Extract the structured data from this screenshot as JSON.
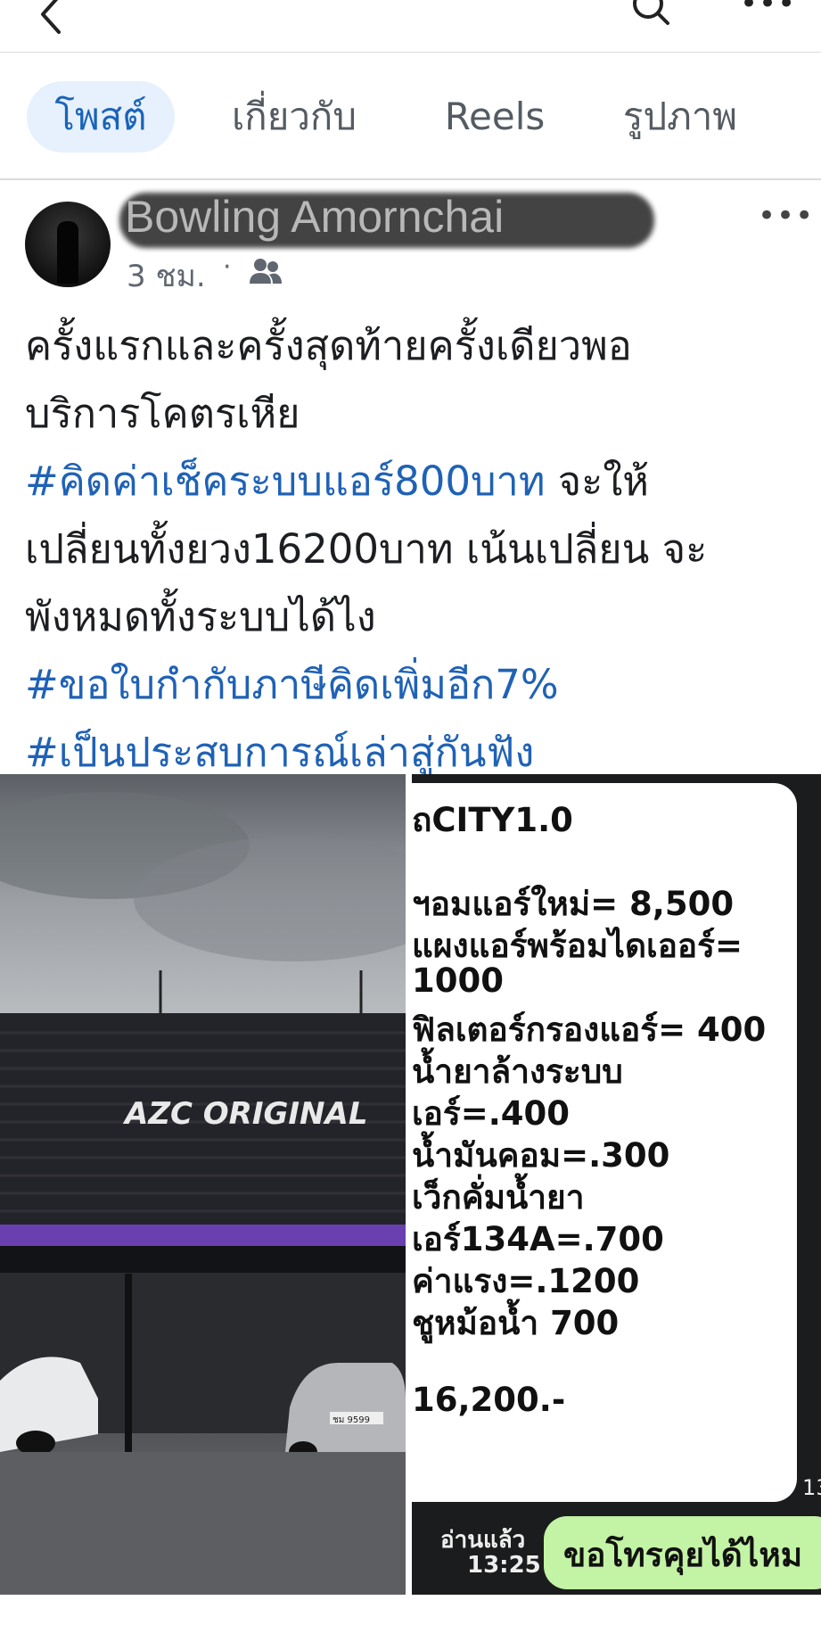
{
  "header": {
    "back_icon": "back-chevron-icon",
    "search_icon": "search-icon",
    "more_icon": "more-dots-icon",
    "more_glyph": "•••"
  },
  "tabs": [
    {
      "label": "โพสต์",
      "selected": true
    },
    {
      "label": "เกี่ยวกับ",
      "selected": false
    },
    {
      "label": "Reels",
      "selected": false
    },
    {
      "label": "รูปภาพ",
      "selected": false
    }
  ],
  "post": {
    "author": "Bowling Amornchai",
    "time": "3 ชม.",
    "separator": "·",
    "audience_icon": "friends-icon",
    "more_glyph": "•••",
    "lines": [
      {
        "parts": [
          {
            "text": "ครั้งแรกและครั้งสุดท้ายครั้งเดียวพอ",
            "tag": false
          }
        ]
      },
      {
        "parts": [
          {
            "text": "บริการโคตรเหีย",
            "tag": false
          }
        ]
      },
      {
        "parts": [
          {
            "text": "#คิดค่าเช็คระบบแอร์800บาท",
            "tag": true
          },
          {
            "text": "  จะให้",
            "tag": false
          }
        ]
      },
      {
        "parts": [
          {
            "text": "เปลี่ยนทั้งยวง16200บาท เน้นเปลี่ยน จะ",
            "tag": false
          }
        ]
      },
      {
        "parts": [
          {
            "text": "พังหมดทั้งระบบได้ไง",
            "tag": false
          }
        ]
      },
      {
        "parts": [
          {
            "text": "#ขอใบกำกับภาษีคิดเพิ่มอีก7%",
            "tag": true
          }
        ]
      },
      {
        "parts": [
          {
            "text": "#เป็นประสบการณ์เล่าสู่กันฟัง",
            "tag": true
          }
        ]
      }
    ]
  },
  "photo_left": {
    "sign_text": "AZC ORIGINAL",
    "plate_text": "ชม 9599"
  },
  "photo_right": {
    "chat_lines": [
      "ถCITY1.0",
      "",
      "ฯอมแอร์ใหม่= 8,500",
      "แผงแอร์พร้อมไดเออร์=",
      "1000",
      "ฟิลเตอร์กรองแอร์= 400",
      "น้ำยาล้างระบบ",
      "เอร์=.400",
      "น้ำมันคอม=.300",
      "เว็กคั่มน้ำยา",
      "เอร์134A=.700",
      "ค่าแรง=.1200",
      "ชูหม้อน้ำ 700",
      "",
      "16,200.-"
    ],
    "read_label": "อ่านแล้ว",
    "read_time": "13:25",
    "reply": "ขอโทรคุยได้ไหม",
    "edge_time": "13"
  }
}
